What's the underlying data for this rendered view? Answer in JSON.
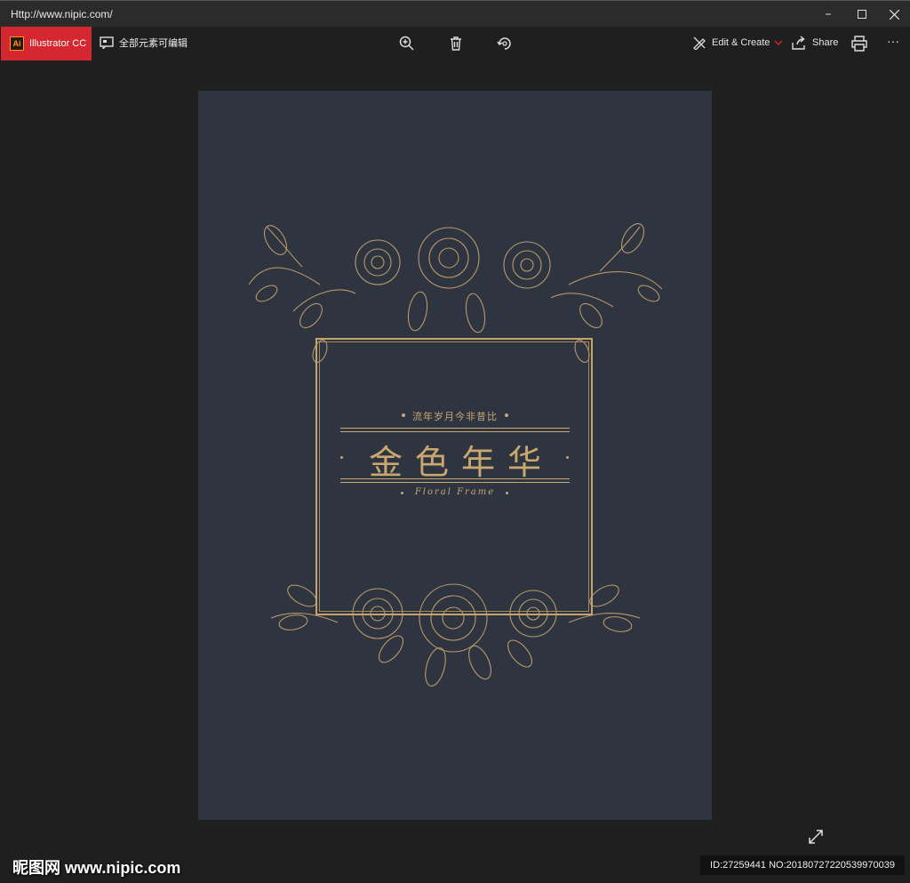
{
  "window": {
    "title": "Http://www.nipic.com/",
    "controls": [
      "minimize-icon",
      "maximize-icon",
      "close-icon"
    ]
  },
  "toolbar": {
    "app_tab_label": "Illustrator CC",
    "app_logo_text": "Ai",
    "editable_label": "全部元素可编辑",
    "center_icons": [
      "zoom-in-icon",
      "delete-icon",
      "rotate-icon"
    ],
    "edit_create_label": "Edit & Create",
    "share_label": "Share",
    "more_label": "···",
    "accent": "#d4272f"
  },
  "poster": {
    "background": "#2f3441",
    "gold": "#c7a872",
    "subtitle": "流年岁月今非昔比",
    "title": "金色年华",
    "english": "Floral Frame"
  },
  "footer": {
    "watermark": "昵图网 www.nipic.com",
    "id_text": "ID:27259441 NO:20180727220539970039"
  }
}
